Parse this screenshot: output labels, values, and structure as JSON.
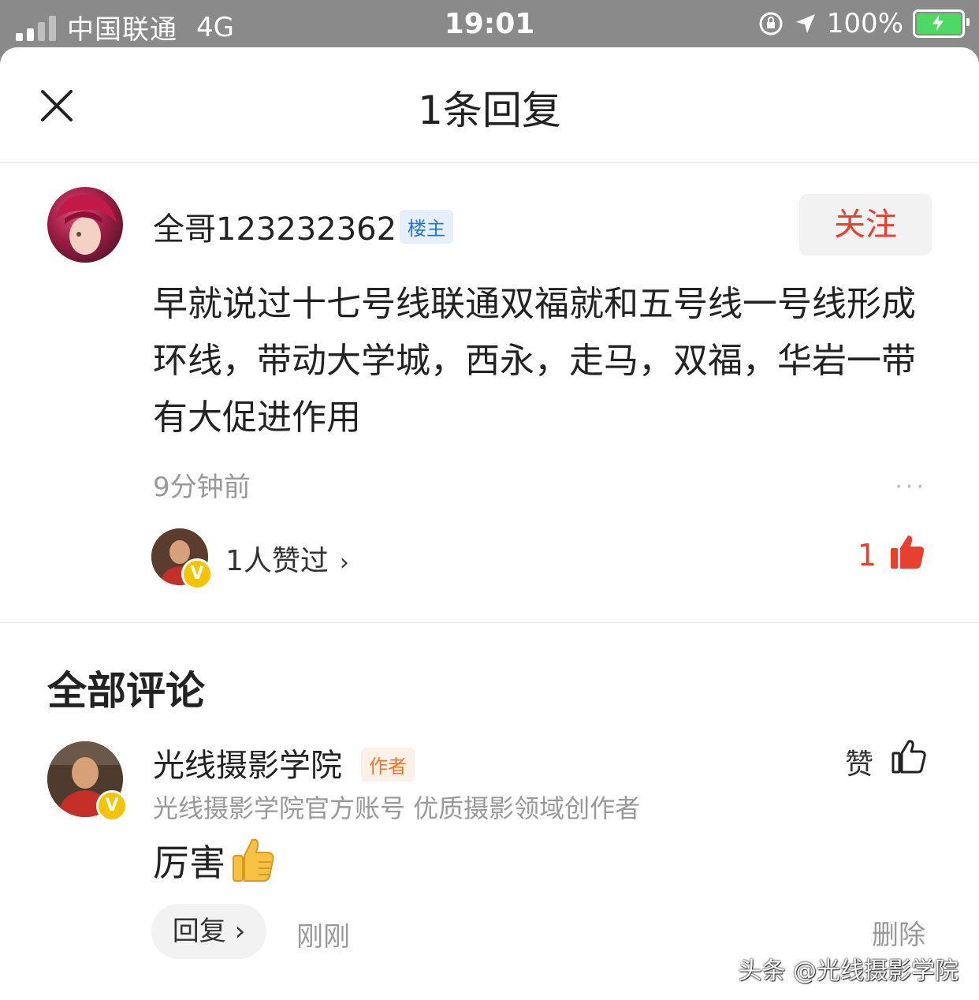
{
  "status_bar": {
    "carrier": "中国联通",
    "network": "4G",
    "time": "19:01",
    "battery": "100%"
  },
  "header": {
    "title": "1条回复"
  },
  "main_comment": {
    "username": "全哥123232362",
    "badge": "楼主",
    "follow_label": "关注",
    "text": "早就说过十七号线联通双福就和五号线一号线形成环线，带动大学城，西永，走马，双福，华岩一带有大促进作用",
    "time": "9分钟前",
    "more": "···",
    "likes_text": "1人赞过",
    "like_count": "1"
  },
  "section": {
    "title": "全部评论"
  },
  "reply": {
    "username": "光线摄影学院",
    "badge": "作者",
    "bio": "光线摄影学院官方账号 优质摄影领域创作者",
    "text": "厉害",
    "like_label": "赞",
    "reply_label": "回复 ›",
    "time": "刚刚",
    "delete_label": "删除"
  },
  "watermark": "头条 @光线摄影学院",
  "colors": {
    "accent_red": "#e8402f",
    "owner_badge": "#2a72d4",
    "author_badge": "#e8772f",
    "verified": "#f5c400"
  }
}
